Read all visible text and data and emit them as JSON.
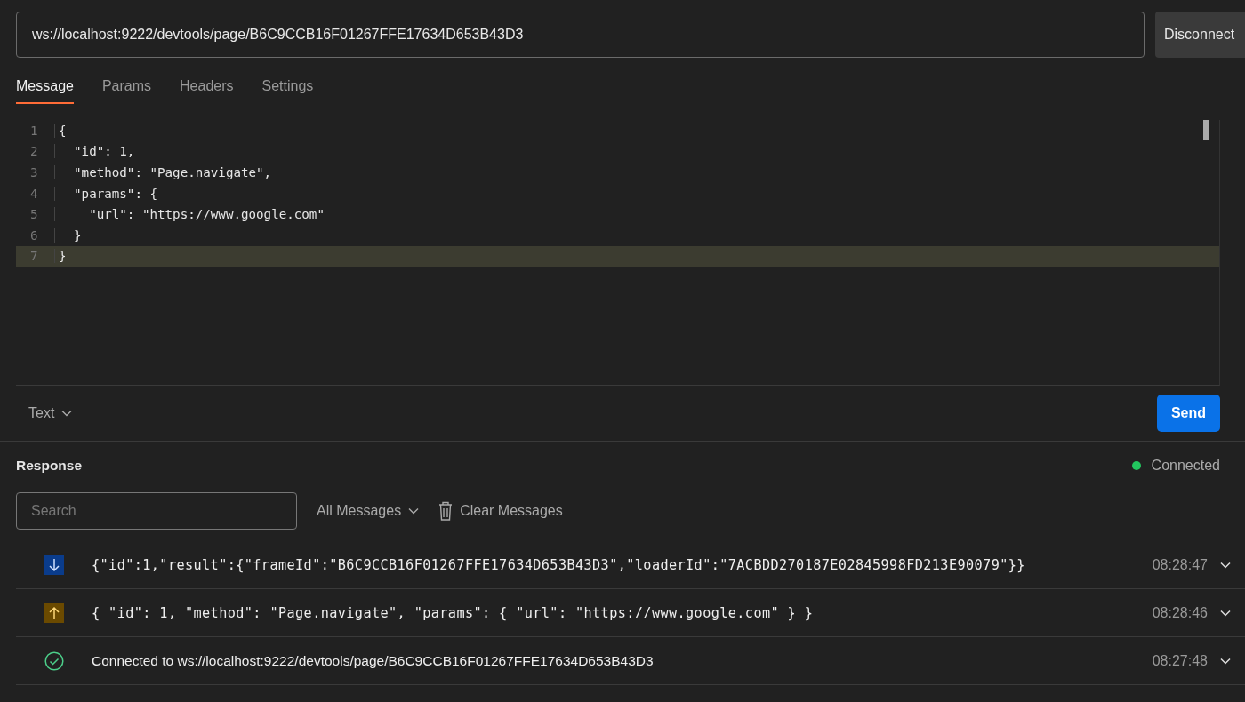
{
  "url_field": {
    "value": "ws://localhost:9222/devtools/page/B6C9CCB16F01267FFE17634D653B43D3"
  },
  "connect_button": {
    "label": "Disconnect"
  },
  "tabs": [
    {
      "label": "Message",
      "selected": true
    },
    {
      "label": "Params",
      "selected": false
    },
    {
      "label": "Headers",
      "selected": false
    },
    {
      "label": "Settings",
      "selected": false
    }
  ],
  "editor": {
    "lines": [
      {
        "number": "1",
        "text": "{",
        "current": false
      },
      {
        "number": "2",
        "text": "  \"id\": 1,",
        "current": false
      },
      {
        "number": "3",
        "text": "  \"method\": \"Page.navigate\",",
        "current": false
      },
      {
        "number": "4",
        "text": "  \"params\": {",
        "current": false
      },
      {
        "number": "5",
        "text": "    \"url\": \"https://www.google.com\"",
        "current": false
      },
      {
        "number": "6",
        "text": "  }",
        "current": false
      },
      {
        "number": "7",
        "text": "}",
        "current": true
      }
    ]
  },
  "format_dropdown": {
    "label": "Text"
  },
  "send_button": {
    "label": "Send"
  },
  "response": {
    "title": "Response",
    "status": {
      "label": "Connected",
      "color": "#22c55e"
    },
    "search": {
      "placeholder": "Search"
    },
    "filter_dropdown": {
      "label": "All Messages"
    },
    "clear_button": {
      "label": "Clear Messages"
    },
    "messages": [
      {
        "kind": "incoming",
        "text": "{\"id\":1,\"result\":{\"frameId\":\"B6C9CCB16F01267FFE17634D653B43D3\",\"loaderId\":\"7ACBDD270187E02845998FD213E90079\"}}",
        "time": "08:28:47"
      },
      {
        "kind": "outgoing",
        "text": "{ \"id\": 1, \"method\": \"Page.navigate\", \"params\": { \"url\": \"https://www.google.com\" } }",
        "time": "08:28:46"
      },
      {
        "kind": "connected",
        "text": "Connected to ws://localhost:9222/devtools/page/B6C9CCB16F01267FFE17634D653B43D3",
        "time": "08:27:48"
      }
    ]
  }
}
